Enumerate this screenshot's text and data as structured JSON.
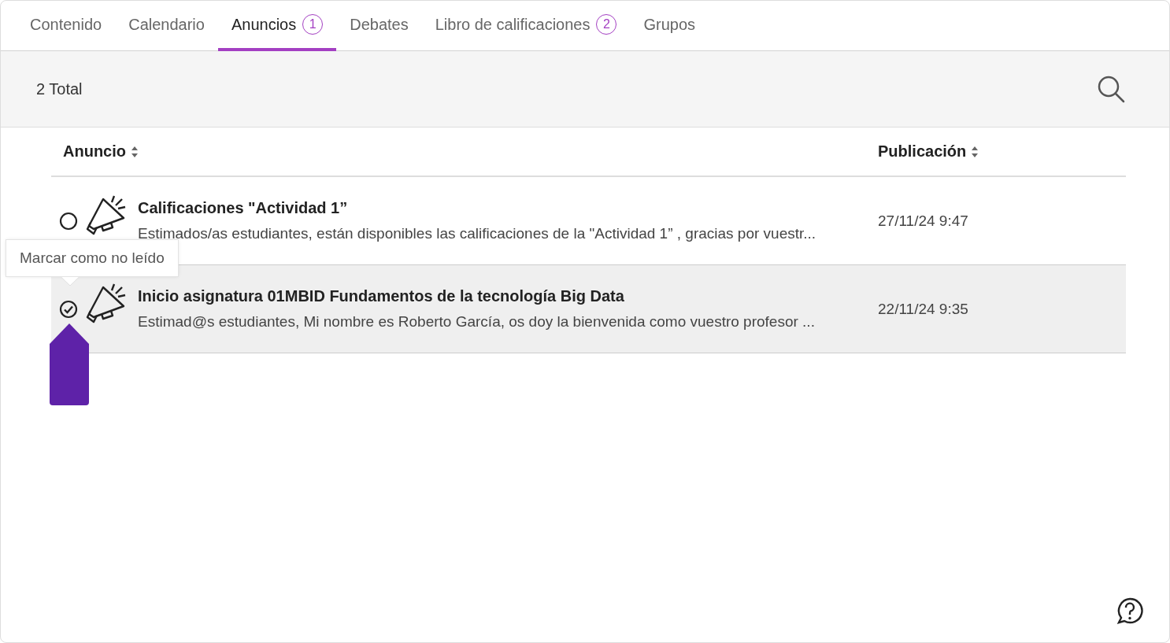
{
  "tabs": [
    {
      "label": "Contenido",
      "selected": false
    },
    {
      "label": "Calendario",
      "selected": false
    },
    {
      "label": "Anuncios",
      "badge": "1",
      "selected": true
    },
    {
      "label": "Debates",
      "selected": false
    },
    {
      "label": "Libro de calificaciones",
      "badge": "2",
      "selected": false
    },
    {
      "label": "Grupos",
      "selected": false
    }
  ],
  "toolbar": {
    "total": "2 Total"
  },
  "table": {
    "columns": [
      "Anuncio",
      "Publicación"
    ],
    "rows": [
      {
        "title": "Calificaciones \"Actividad 1”",
        "preview": "Estimados/as estudiantes, están disponibles las calificaciones de la \"Actividad 1” , gracias por vuestr...",
        "date": "27/11/24 9:47",
        "read": false,
        "selected": false
      },
      {
        "title": "Inicio asignatura 01MBID Fundamentos de la tecnología Big Data",
        "preview": "Estimad@s estudiantes, Mi nombre es Roberto García, os doy la bienvenida como vuestro profesor ...",
        "date": "22/11/24 9:35",
        "read": true,
        "selected": true
      }
    ]
  },
  "tooltip": {
    "text": "Marcar como no leído"
  }
}
